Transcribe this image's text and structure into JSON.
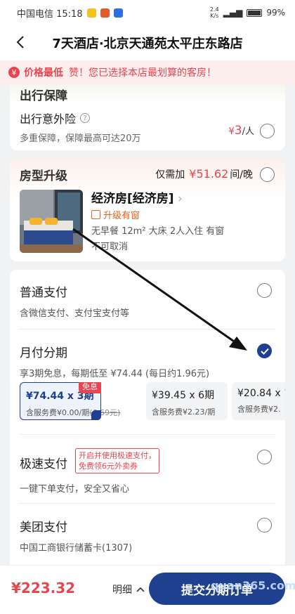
{
  "status_bar": {
    "carrier_time": "中国电信 15:18",
    "speed_top": "2.4",
    "speed_bottom": "K/s",
    "battery": "99%"
  },
  "nav": {
    "title": "7天酒店·北京天通苑太平庄东路店"
  },
  "banner": {
    "label": "价格最低",
    "message": "赞！您已选择本店最划算的客房！"
  },
  "insurance": {
    "section_title": "出行保障",
    "name": "出行意外险",
    "desc": "多重保障，保障最高可达20万",
    "price_symbol": "¥",
    "price_value": "3",
    "price_unit": "/人"
  },
  "upgrade": {
    "section_title": "房型升级",
    "extra_prefix": "仅需加",
    "extra_price": "¥51.62",
    "extra_unit": "间/晚",
    "room_name": "经济房[经济房]",
    "room_tag": "升级有窗",
    "room_info": "无早餐 12m² 大床 2人入住 有窗",
    "room_cancel": "不可取消"
  },
  "payment": {
    "normal": {
      "name": "普通支付",
      "sub": "含微信支付、支付宝支付等"
    },
    "monthly": {
      "name": "月付分期",
      "sub": "享3期免息，每期低至 ¥74.44 (每日约1.96元)",
      "plans": [
        {
          "amount": "¥74.44 x 3期",
          "fee": "含服务费¥0.00/期",
          "fee_original": "(6.69元)",
          "badge": "免息"
        },
        {
          "amount": "¥39.45 x 6期",
          "fee": "含服务费¥2.23/期"
        },
        {
          "amount": "¥20.84 x 1",
          "fee": "含服务费¥2."
        }
      ]
    },
    "fast": {
      "name": "极速支付",
      "promo": "开启并使用极速支付，免费领6元外卖券",
      "sub": "一键下单支付，安全又省心"
    },
    "meituan": {
      "name": "美团支付",
      "sub": "中国工商银行储蓄卡(1307)"
    }
  },
  "bottom": {
    "total": "¥223.32",
    "detail": "明细",
    "submit": "提交分期订单",
    "watermark": "quan365.com"
  },
  "colors": {
    "accent_blue": "#1f3f8f",
    "price_red": "#e8454f",
    "tag_orange": "#e0651e"
  }
}
